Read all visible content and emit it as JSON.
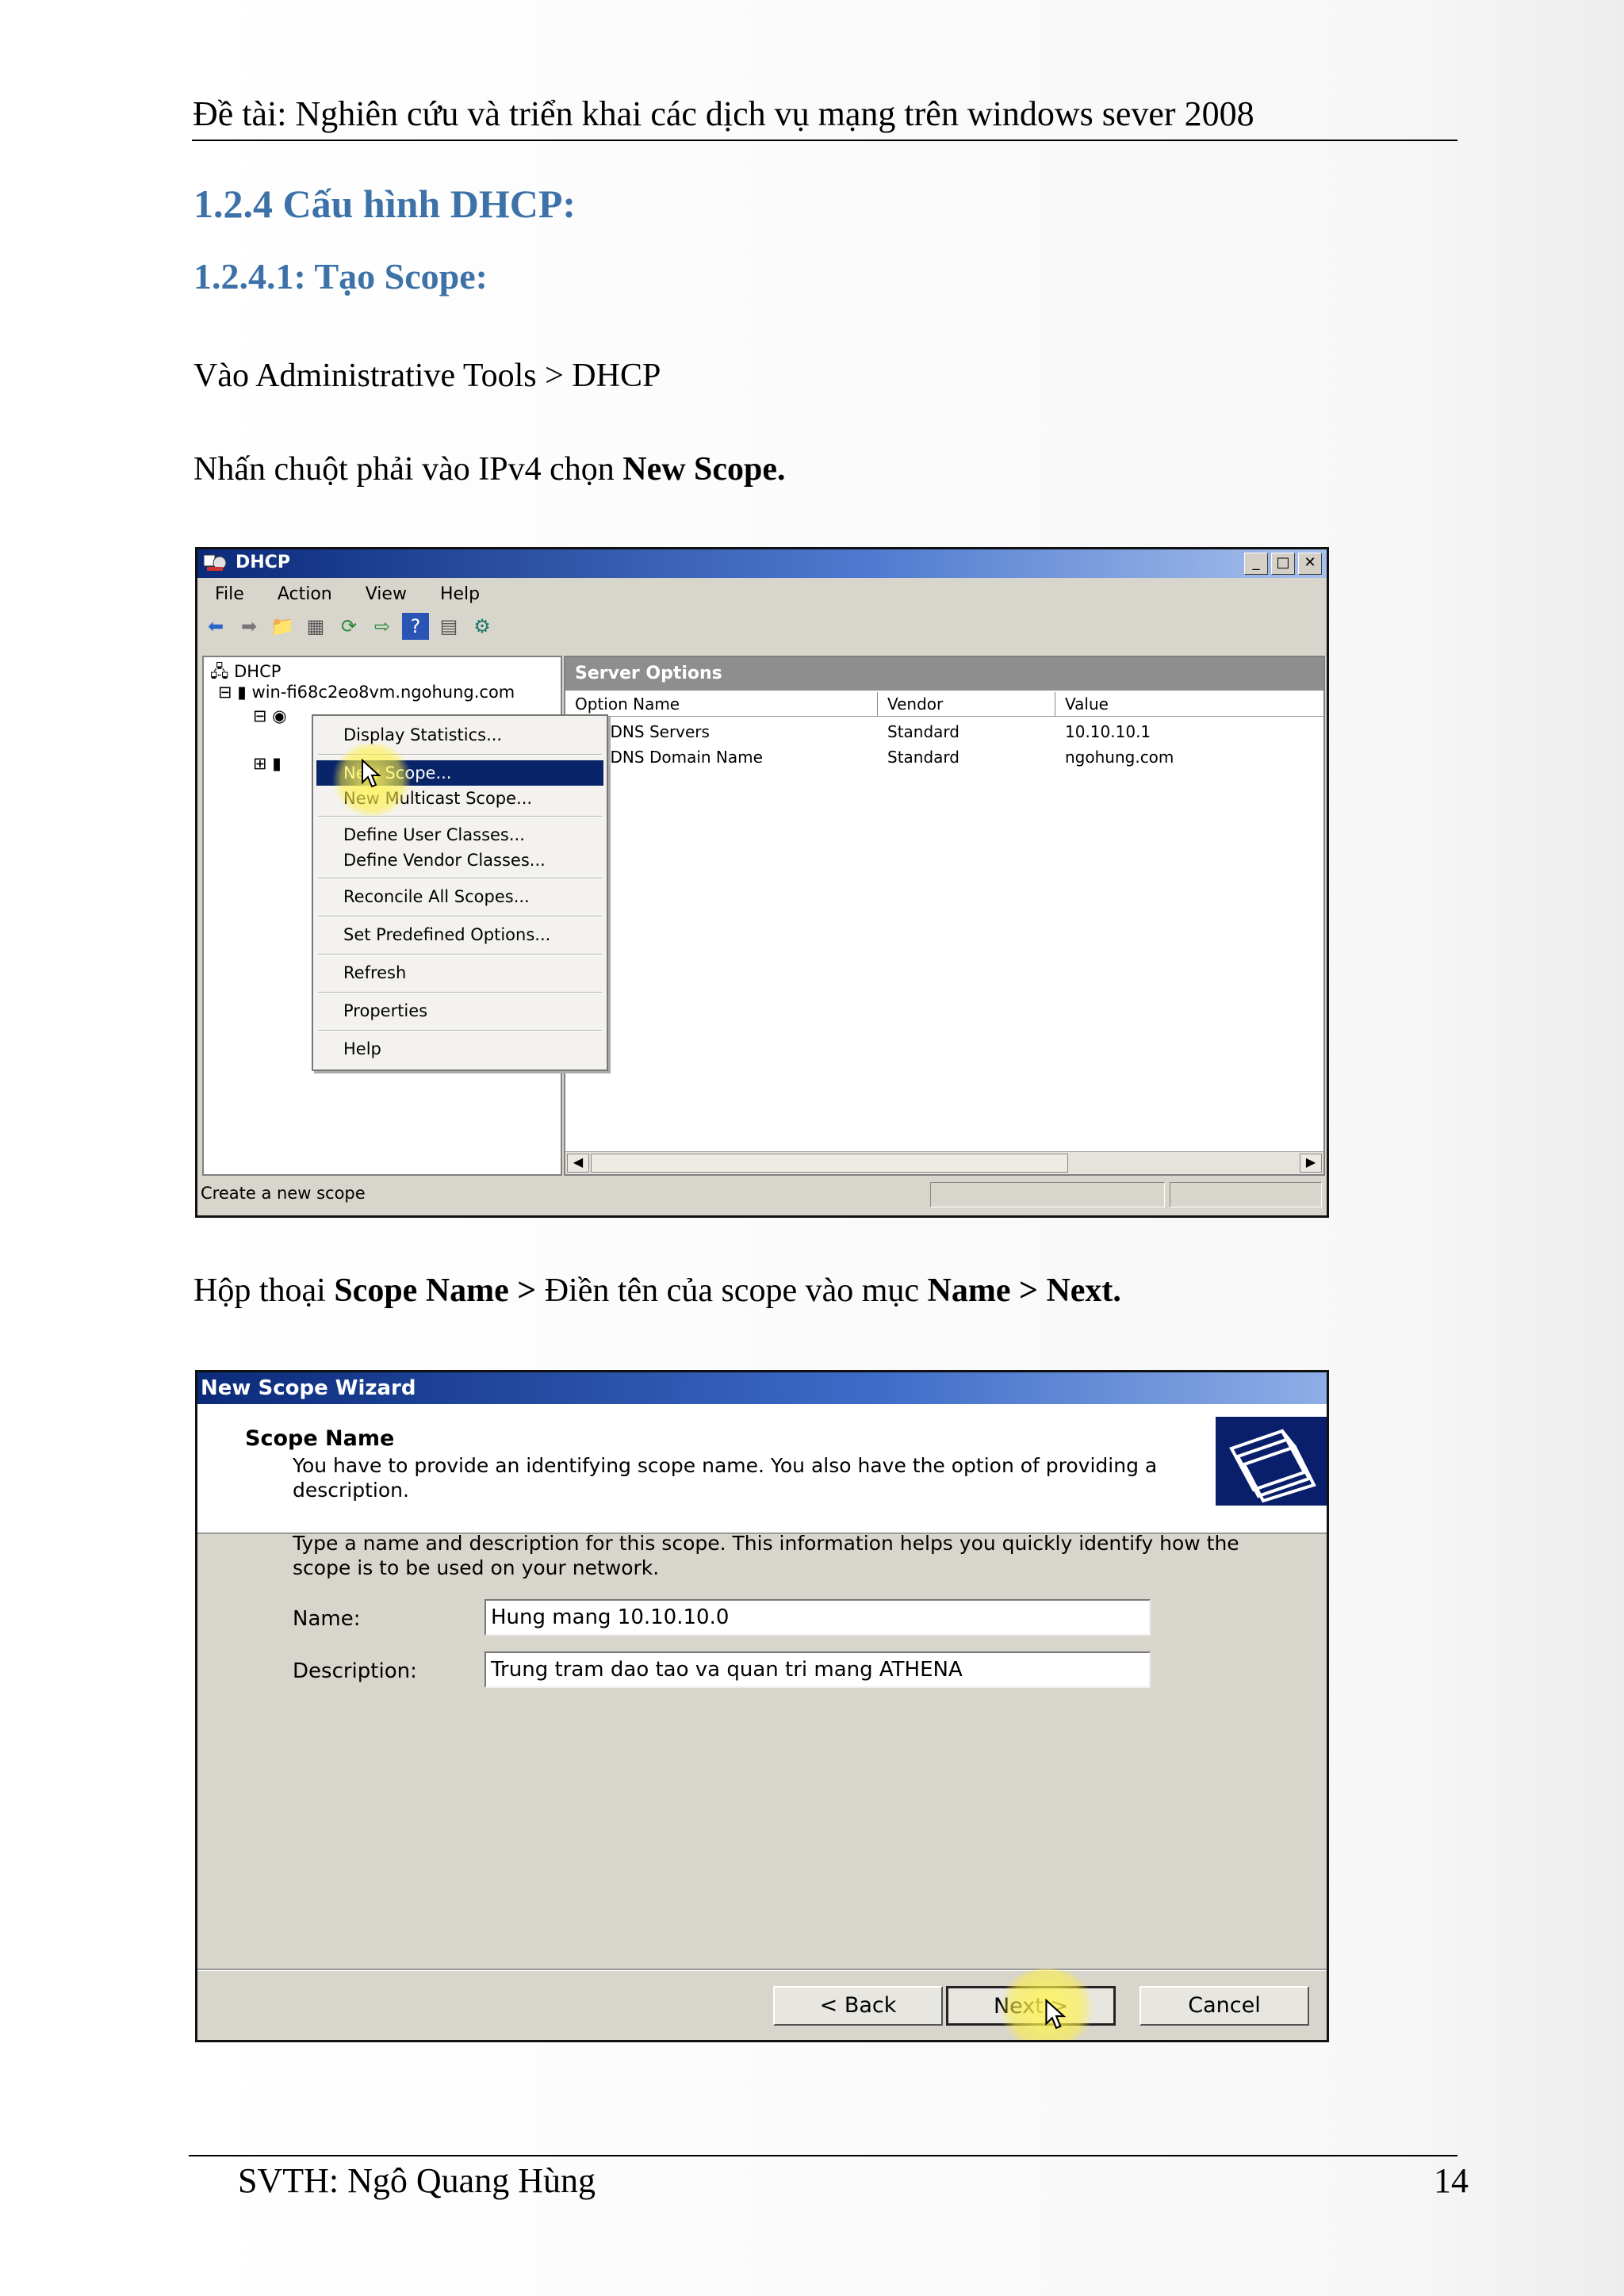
{
  "header": "Đề tài: Nghiên cứu và triển khai các dịch vụ mạng trên windows sever 2008",
  "heading1": "1.2.4 Cấu hình DHCP:",
  "heading2": "1.2.4.1: Tạo Scope:",
  "para1": "Vào Administrative Tools > DHCP",
  "para2": {
    "pre": "Nhấn chuột phải vào IPv4 chọn ",
    "bold": "New Scope."
  },
  "para3": {
    "pre": "Hộp thoại ",
    "b1": "Scope Name >",
    "mid": " Điền tên của scope vào mục ",
    "b2": "Name > Next."
  },
  "footer": {
    "left": "SVTH: Ngô Quang Hùng",
    "page": "14"
  },
  "dhcp": {
    "title": "DHCP",
    "window_buttons": [
      "_",
      "□",
      "✕"
    ],
    "menu": [
      "File",
      "Action",
      "View",
      "Help"
    ],
    "tree": {
      "root": "DHCP",
      "server": "win-fi68c2eo8vm.ngohung.com"
    },
    "pane_title": "Server Options",
    "columns": [
      "Option Name",
      "Vendor",
      "Value"
    ],
    "rows": [
      {
        "name": "006 DNS Servers",
        "vendor": "Standard",
        "value": "10.10.10.1"
      },
      {
        "name": "015 DNS Domain Name",
        "vendor": "Standard",
        "value": "ngohung.com"
      }
    ],
    "context_menu": [
      "Display Statistics...",
      "New Scope...",
      "New Multicast Scope...",
      "Define User Classes...",
      "Define Vendor Classes...",
      "Reconcile All Scopes...",
      "Set Predefined Options...",
      "Refresh",
      "Properties",
      "Help"
    ],
    "selected_item": "New Scope...",
    "status": "Create a new scope"
  },
  "wizard": {
    "title": "New Scope Wizard",
    "page_title": "Scope Name",
    "page_desc": "You have to provide an identifying scope name. You also have the option of providing a description.",
    "instructions": "Type a name and description for this scope. This information helps you quickly identify how the scope is to be used on your network.",
    "name_label": "Name:",
    "name_value": "Hung mang 10.10.10.0",
    "desc_label": "Description:",
    "desc_value": "Trung tram dao tao va quan tri mang ATHENA",
    "buttons": {
      "back": "< Back",
      "next": "Next >",
      "cancel": "Cancel"
    }
  }
}
